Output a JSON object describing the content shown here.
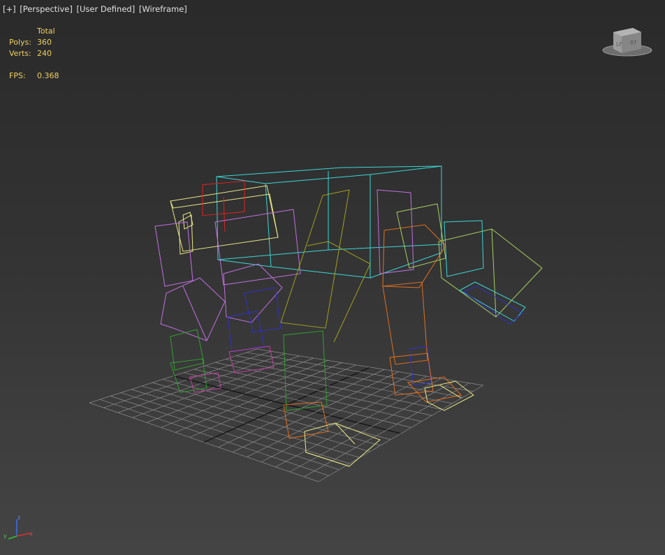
{
  "viewport": {
    "menu_label": "[+]",
    "view_label": "[Perspective]",
    "shading_label": "[User Defined]",
    "display_label": "[Wireframe]"
  },
  "stats": {
    "header": "Total",
    "polys_label": "Polys:",
    "polys_value": "360",
    "verts_label": "Verts:",
    "verts_value": "240",
    "fps_label": "FPS:",
    "fps_value": "0.368"
  },
  "viewcube": {
    "left_face": "LF",
    "right_face": "RT"
  },
  "axis_gizmo": {
    "x": "x",
    "y": "y",
    "z": "z"
  },
  "colors": {
    "stats_text": "#f0d060",
    "grid": "#8a8a8a",
    "grid_center": "#141414",
    "wire_cyan": "#3cd6d6",
    "wire_yellow": "#e8e888",
    "wire_lime": "#a8d060",
    "wire_purple": "#c070e0",
    "wire_magenta": "#c040a0",
    "wire_blue": "#3030c8",
    "wire_green": "#30a030",
    "wire_orange": "#e07020",
    "wire_red": "#e02020",
    "wire_olive": "#a0a020"
  }
}
